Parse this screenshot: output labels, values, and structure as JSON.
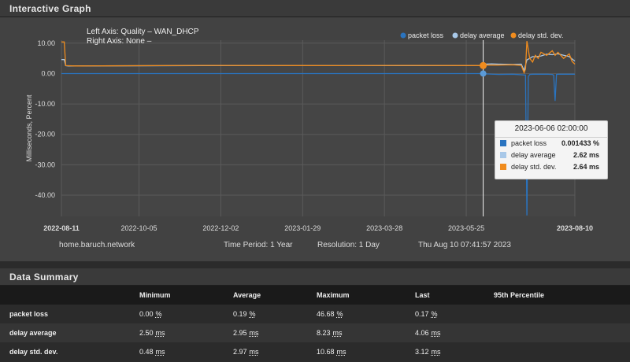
{
  "graph_panel": {
    "title": "Interactive Graph"
  },
  "chart_data": {
    "type": "line",
    "left_axis_label": "Left Axis: Quality – WAN_DHCP",
    "right_axis_label": "Right Axis: None –",
    "ylabel": "Milliseconds, Percent",
    "ylim": [
      -47,
      11
    ],
    "y_ticks": [
      "10.00",
      "0.00",
      "-10.00",
      "-20.00",
      "-30.00",
      "-40.00"
    ],
    "y_tick_values": [
      10,
      0,
      -10,
      -20,
      -30,
      -40
    ],
    "x_ticks": [
      "2022-08-11",
      "2022-10-05",
      "2022-12-02",
      "2023-01-29",
      "2023-03-28",
      "2023-05-25",
      "2023-08-10"
    ],
    "x_tick_bold": [
      true,
      false,
      false,
      false,
      false,
      false,
      true
    ],
    "x_tick_days": [
      0,
      55,
      113,
      171,
      229,
      287,
      364
    ],
    "x_range_days": [
      0,
      364
    ],
    "legend": [
      {
        "name": "packet loss",
        "color": "#2a74c0"
      },
      {
        "name": "delay average",
        "color": "#a8c8e8"
      },
      {
        "name": "delay std. dev.",
        "color": "#f08c1e"
      }
    ],
    "series": [
      {
        "name": "packet loss",
        "color": "#2a74c0",
        "x_days": [
          0,
          100,
          200,
          250,
          299,
          300,
          310,
          320,
          329,
          330,
          331,
          332,
          334,
          335,
          336,
          338,
          342,
          345,
          348,
          349,
          350,
          351,
          352,
          355,
          358,
          364
        ],
        "values": [
          0,
          0,
          0,
          0,
          0,
          -0.1,
          -0.3,
          -0.2,
          -0.5,
          -46.68,
          -1,
          -0.3,
          -0.2,
          -0.2,
          -0.2,
          -0.2,
          -0.2,
          -0.2,
          -0.3,
          -0.5,
          -9,
          -0.3,
          -0.2,
          -0.2,
          -0.2,
          -0.2
        ]
      },
      {
        "name": "delay average",
        "color": "#a8c8e8",
        "x_days": [
          0,
          2,
          3,
          5,
          100,
          200,
          250,
          299,
          300,
          305,
          310,
          320,
          326,
          328,
          330,
          332,
          334,
          336,
          340,
          344,
          348,
          352,
          356,
          360,
          362,
          364
        ],
        "values": [
          4.6,
          4.6,
          2.6,
          2.5,
          2.6,
          2.6,
          2.6,
          2.62,
          3.1,
          3.2,
          3.1,
          3.0,
          3.1,
          1.0,
          4.5,
          5.0,
          5.6,
          5.5,
          5.8,
          6.4,
          6.2,
          6.5,
          6.0,
          5.6,
          4.8,
          4.1
        ]
      },
      {
        "name": "delay std. dev.",
        "color": "#f08c1e",
        "x_days": [
          0,
          2,
          3,
          10,
          100,
          200,
          250,
          299,
          300,
          310,
          320,
          326,
          328,
          329,
          330,
          332,
          334,
          336,
          338,
          340,
          344,
          348,
          350,
          352,
          356,
          360,
          362,
          364
        ],
        "values": [
          10.4,
          10.4,
          2.6,
          2.5,
          2.7,
          2.6,
          2.7,
          2.64,
          2.8,
          2.8,
          2.9,
          2.7,
          0.3,
          1.5,
          10.68,
          5.0,
          3.8,
          6.0,
          5.0,
          7.0,
          6.0,
          7.5,
          6.0,
          7.0,
          5.0,
          6.5,
          4.0,
          3.1
        ]
      }
    ],
    "crosshair_day": 299
  },
  "tooltip": {
    "date": "2023-06-06 02:00:00",
    "rows": [
      {
        "name": "packet loss",
        "value": "0.001433 %",
        "color": "#2a74c0"
      },
      {
        "name": "delay average",
        "value": "2.62 ms",
        "color": "#a8c8e8"
      },
      {
        "name": "delay std. dev.",
        "value": "2.64 ms",
        "color": "#f08c1e"
      }
    ]
  },
  "footer": {
    "host": "home.baruch.network",
    "time_period": "Time Period: 1 Year",
    "resolution": "Resolution: 1 Day",
    "timestamp": "Thu Aug 10 07:41:57 2023"
  },
  "summary": {
    "title": "Data Summary",
    "columns": [
      "",
      "Minimum",
      "Average",
      "Maximum",
      "Last",
      "95th Percentile"
    ],
    "rows": [
      {
        "name": "packet loss",
        "values": [
          [
            "0.00",
            "%"
          ],
          [
            "0.19",
            "%"
          ],
          [
            "46.68",
            "%"
          ],
          [
            "0.17",
            "%"
          ],
          [
            "",
            ""
          ]
        ]
      },
      {
        "name": "delay average",
        "values": [
          [
            "2.50",
            "ms"
          ],
          [
            "2.95",
            "ms"
          ],
          [
            "8.23",
            "ms"
          ],
          [
            "4.06",
            "ms"
          ],
          [
            "",
            ""
          ]
        ]
      },
      {
        "name": "delay std. dev.",
        "values": [
          [
            "0.48",
            "ms"
          ],
          [
            "2.97",
            "ms"
          ],
          [
            "10.68",
            "ms"
          ],
          [
            "3.12",
            "ms"
          ],
          [
            "",
            ""
          ]
        ]
      }
    ]
  }
}
